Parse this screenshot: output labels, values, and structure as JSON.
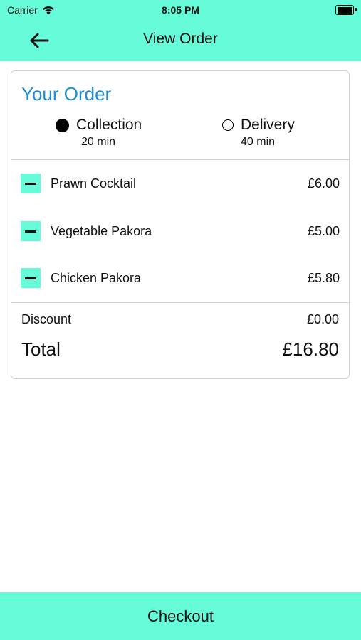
{
  "status_bar": {
    "carrier": "Carrier",
    "time": "8:05 PM"
  },
  "header": {
    "title": "View Order",
    "back_icon": "arrow-left-icon",
    "background": "#66FCD9"
  },
  "order": {
    "title": "Your Order",
    "options": [
      {
        "label": "Collection",
        "time": "20 min",
        "selected": true
      },
      {
        "label": "Delivery",
        "time": "40 min",
        "selected": false
      }
    ],
    "items": [
      {
        "name": "Prawn Cocktail",
        "price": "£6.00"
      },
      {
        "name": "Vegetable Pakora",
        "price": "£5.00"
      },
      {
        "name": "Chicken Pakora",
        "price": "£5.80"
      }
    ],
    "discount_label": "Discount",
    "discount_value": "£0.00",
    "total_label": "Total",
    "total_value": "£16.80"
  },
  "footer": {
    "checkout_label": "Checkout"
  },
  "colors": {
    "accent": "#66FCD9",
    "title_blue": "#1E8FD6"
  }
}
